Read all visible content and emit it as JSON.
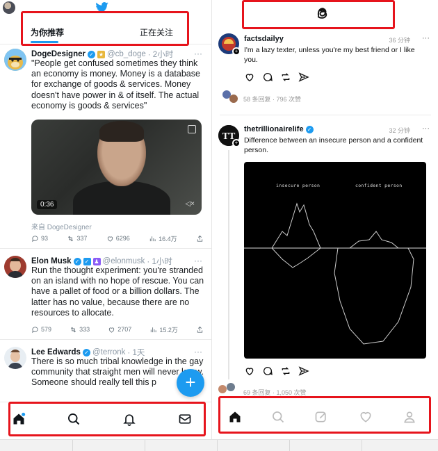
{
  "twitter": {
    "tabs": {
      "for_you": "为你推荐",
      "following": "正在关注"
    },
    "tweets": [
      {
        "name": "DogeDesigner",
        "handle": "@cb_doge",
        "time": "· 2小时",
        "text": "\"People get confused sometimes they think an economy is money. Money is a database for exchange of goods & services. Money doesn't have power in & of itself. The actual economy is goods & services\"",
        "video_time": "0:36",
        "source": "来自 DogeDesigner",
        "replies": "93",
        "retweets": "337",
        "likes": "6296",
        "views": "16.4万"
      },
      {
        "name": "Elon Musk",
        "handle": "@elonmusk",
        "time": "· 1小时",
        "text": "Run the thought experiment: you're stranded on an island with no hope of rescue. You can have a pallet of food or a billion dollars. The latter has no value, because there are no resources to allocate.",
        "replies": "579",
        "retweets": "333",
        "likes": "2707",
        "views": "15.2万"
      },
      {
        "name": "Lee Edwards",
        "handle": "@terronk",
        "time": "· 1天",
        "text": "There is so much tribal knowledge in the gay community that straight men will never know. Someone should really tell this p"
      }
    ],
    "fab_label": "+",
    "nav": [
      "home-icon",
      "search-icon",
      "notifications-bell-icon",
      "messages-mail-icon"
    ],
    "accent": "#1d9bf0"
  },
  "threads": {
    "posts": [
      {
        "username": "factsdailyy",
        "time": "36 分钟",
        "text": "I'm a lazy texter, unless you're my best friend or I like you.",
        "replies": "58 条回复",
        "views": "796 次赞"
      },
      {
        "username": "thetrillionairelife",
        "time": "32 分钟",
        "text": "Difference between an insecure person and a confident person.",
        "image_labels": {
          "left": "insecure person",
          "right": "confident person"
        },
        "replies": "69 条回复",
        "views": "1,050 次赞"
      }
    ],
    "nav": [
      "home-icon",
      "search-icon",
      "compose-icon",
      "activity-heart-icon",
      "profile-icon"
    ]
  },
  "highlight_color": "#e6141c"
}
